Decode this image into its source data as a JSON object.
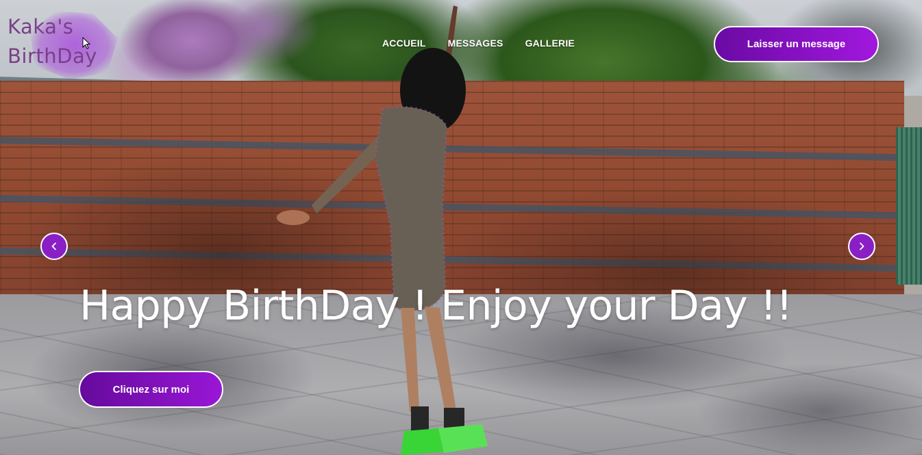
{
  "logo": {
    "line1": "Kaka's",
    "line2": "BirthDay"
  },
  "nav": {
    "items": [
      "ACCUEIL",
      "MESSAGES",
      "GALLERIE"
    ]
  },
  "header": {
    "cta_label": "Laisser un message"
  },
  "hero": {
    "title": "Happy BirthDay ! Enjoy your Day !!",
    "cta_label": "Cliquez sur moi"
  },
  "carousel": {
    "prev_icon": "chevron-left-icon",
    "next_icon": "chevron-right-icon"
  },
  "colors": {
    "accent": "#8a1fc6",
    "accent_dark": "#650a9c",
    "logo_text": "#7a3f8a"
  }
}
